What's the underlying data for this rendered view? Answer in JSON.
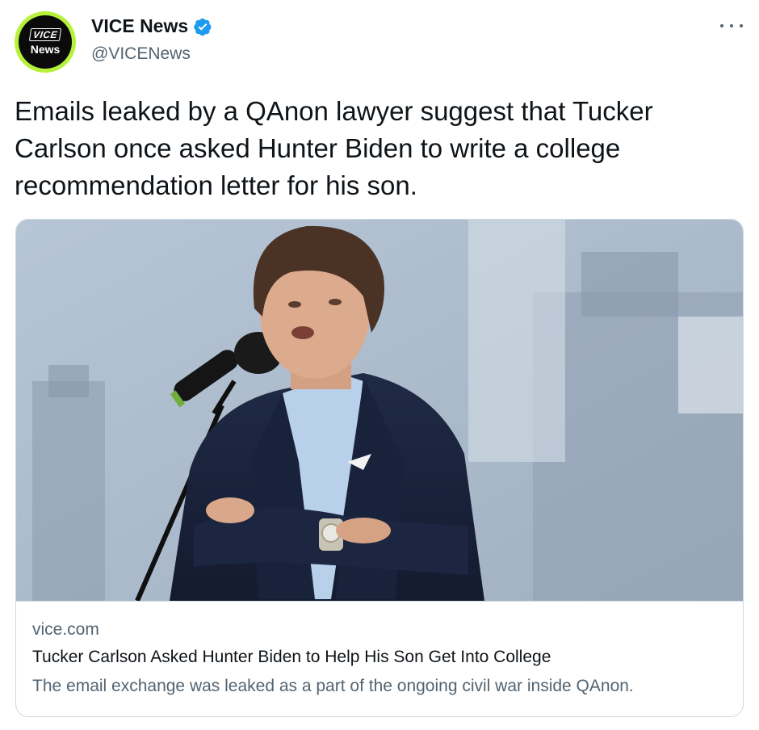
{
  "account": {
    "display_name": "VICE News",
    "handle": "@VICENews",
    "avatar_logo": "VICE",
    "avatar_sub": "News",
    "verified_icon": "verified-badge-icon",
    "verified_color": "#1d9bf0"
  },
  "tweet": {
    "text": "Emails leaked by a QAnon lawyer suggest that Tucker Carlson once asked Hunter Biden to write a college recommendation letter for his son."
  },
  "card": {
    "domain": "vice.com",
    "title": "Tucker Carlson Asked Hunter Biden to Help His Son Get Into College",
    "description": "The email exchange was leaked as a part of the ongoing civil war inside QAnon."
  },
  "colors": {
    "text_primary": "#0f1419",
    "text_secondary": "#536471",
    "border": "#cfd9de",
    "avatar_ring": "#b6f23a"
  },
  "icons": {
    "more": "more-dots-icon"
  }
}
